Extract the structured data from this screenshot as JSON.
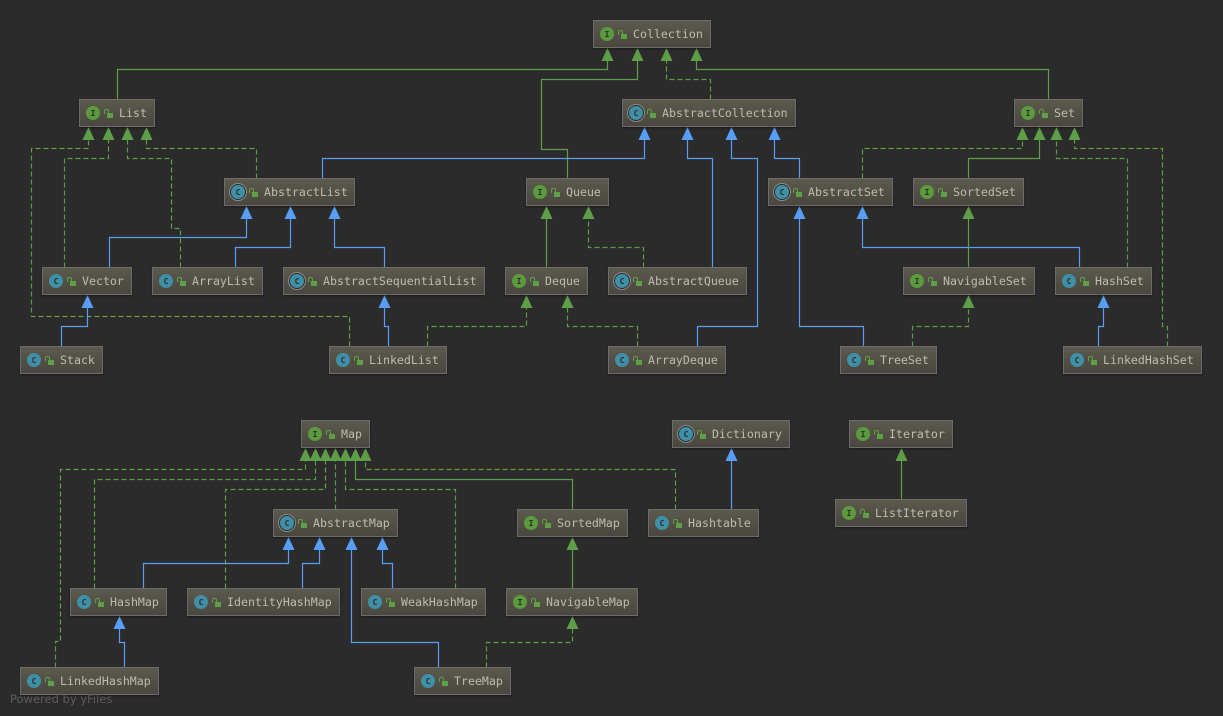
{
  "colors": {
    "background": "#2b2b2b",
    "interface_edge": "#5f9e48",
    "class_edge": "#589df6",
    "node_text": "#bcbcb4"
  },
  "nodes": [
    {
      "id": "Collection",
      "label": "Collection",
      "kind": "interface",
      "badge": "I"
    },
    {
      "id": "List",
      "label": "List",
      "kind": "interface",
      "badge": "I"
    },
    {
      "id": "AbstractCollection",
      "label": "AbstractCollection",
      "kind": "abstract",
      "badge": "C"
    },
    {
      "id": "Set",
      "label": "Set",
      "kind": "interface",
      "badge": "I"
    },
    {
      "id": "AbstractList",
      "label": "AbstractList",
      "kind": "abstract",
      "badge": "C"
    },
    {
      "id": "Queue",
      "label": "Queue",
      "kind": "interface",
      "badge": "I"
    },
    {
      "id": "AbstractSet",
      "label": "AbstractSet",
      "kind": "abstract",
      "badge": "C"
    },
    {
      "id": "SortedSet",
      "label": "SortedSet",
      "kind": "interface",
      "badge": "I"
    },
    {
      "id": "Vector",
      "label": "Vector",
      "kind": "class",
      "badge": "C"
    },
    {
      "id": "ArrayList",
      "label": "ArrayList",
      "kind": "class",
      "badge": "C"
    },
    {
      "id": "AbstractSequentialList",
      "label": "AbstractSequentialList",
      "kind": "abstract",
      "badge": "C"
    },
    {
      "id": "Deque",
      "label": "Deque",
      "kind": "interface",
      "badge": "I"
    },
    {
      "id": "AbstractQueue",
      "label": "AbstractQueue",
      "kind": "abstract",
      "badge": "C"
    },
    {
      "id": "NavigableSet",
      "label": "NavigableSet",
      "kind": "interface",
      "badge": "I"
    },
    {
      "id": "HashSet",
      "label": "HashSet",
      "kind": "class",
      "badge": "C"
    },
    {
      "id": "Stack",
      "label": "Stack",
      "kind": "class",
      "badge": "C"
    },
    {
      "id": "LinkedList",
      "label": "LinkedList",
      "kind": "class",
      "badge": "C"
    },
    {
      "id": "ArrayDeque",
      "label": "ArrayDeque",
      "kind": "class",
      "badge": "C"
    },
    {
      "id": "TreeSet",
      "label": "TreeSet",
      "kind": "class",
      "badge": "C"
    },
    {
      "id": "LinkedHashSet",
      "label": "LinkedHashSet",
      "kind": "class",
      "badge": "C"
    },
    {
      "id": "Map",
      "label": "Map",
      "kind": "interface",
      "badge": "I"
    },
    {
      "id": "Dictionary",
      "label": "Dictionary",
      "kind": "abstract",
      "badge": "C"
    },
    {
      "id": "Iterator",
      "label": "Iterator",
      "kind": "interface",
      "badge": "I"
    },
    {
      "id": "AbstractMap",
      "label": "AbstractMap",
      "kind": "abstract",
      "badge": "C"
    },
    {
      "id": "SortedMap",
      "label": "SortedMap",
      "kind": "interface",
      "badge": "I"
    },
    {
      "id": "Hashtable",
      "label": "Hashtable",
      "kind": "class",
      "badge": "C"
    },
    {
      "id": "ListIterator",
      "label": "ListIterator",
      "kind": "interface",
      "badge": "I"
    },
    {
      "id": "HashMap",
      "label": "HashMap",
      "kind": "class",
      "badge": "C"
    },
    {
      "id": "IdentityHashMap",
      "label": "IdentityHashMap",
      "kind": "class",
      "badge": "C"
    },
    {
      "id": "WeakHashMap",
      "label": "WeakHashMap",
      "kind": "class",
      "badge": "C"
    },
    {
      "id": "NavigableMap",
      "label": "NavigableMap",
      "kind": "interface",
      "badge": "I"
    },
    {
      "id": "LinkedHashMap",
      "label": "LinkedHashMap",
      "kind": "class",
      "badge": "C"
    },
    {
      "id": "TreeMap",
      "label": "TreeMap",
      "kind": "class",
      "badge": "C"
    }
  ],
  "edges": [
    {
      "from": "List",
      "to": "Collection",
      "type": "extends-interface"
    },
    {
      "from": "Queue",
      "to": "Collection",
      "type": "extends-interface"
    },
    {
      "from": "AbstractCollection",
      "to": "Collection",
      "type": "implements"
    },
    {
      "from": "Set",
      "to": "Collection",
      "type": "extends-interface"
    },
    {
      "from": "AbstractList",
      "to": "AbstractCollection",
      "type": "extends-class"
    },
    {
      "from": "AbstractQueue",
      "to": "AbstractCollection",
      "type": "extends-class"
    },
    {
      "from": "ArrayDeque",
      "to": "AbstractCollection",
      "type": "extends-class"
    },
    {
      "from": "AbstractSet",
      "to": "AbstractCollection",
      "type": "extends-class"
    },
    {
      "from": "LinkedList",
      "to": "List",
      "type": "implements"
    },
    {
      "from": "Vector",
      "to": "List",
      "type": "implements"
    },
    {
      "from": "ArrayList",
      "to": "List",
      "type": "implements"
    },
    {
      "from": "AbstractList",
      "to": "List",
      "type": "implements"
    },
    {
      "from": "Vector",
      "to": "AbstractList",
      "type": "extends-class"
    },
    {
      "from": "ArrayList",
      "to": "AbstractList",
      "type": "extends-class"
    },
    {
      "from": "AbstractSequentialList",
      "to": "AbstractList",
      "type": "extends-class"
    },
    {
      "from": "Stack",
      "to": "Vector",
      "type": "extends-class"
    },
    {
      "from": "LinkedList",
      "to": "AbstractSequentialList",
      "type": "extends-class"
    },
    {
      "from": "Deque",
      "to": "Queue",
      "type": "extends-interface"
    },
    {
      "from": "AbstractQueue",
      "to": "Queue",
      "type": "implements"
    },
    {
      "from": "LinkedList",
      "to": "Deque",
      "type": "implements"
    },
    {
      "from": "ArrayDeque",
      "to": "Deque",
      "type": "implements"
    },
    {
      "from": "AbstractSet",
      "to": "Set",
      "type": "implements"
    },
    {
      "from": "SortedSet",
      "to": "Set",
      "type": "extends-interface"
    },
    {
      "from": "HashSet",
      "to": "Set",
      "type": "implements"
    },
    {
      "from": "LinkedHashSet",
      "to": "Set",
      "type": "implements"
    },
    {
      "from": "TreeSet",
      "to": "AbstractSet",
      "type": "extends-class"
    },
    {
      "from": "HashSet",
      "to": "AbstractSet",
      "type": "extends-class"
    },
    {
      "from": "NavigableSet",
      "to": "SortedSet",
      "type": "extends-interface"
    },
    {
      "from": "TreeSet",
      "to": "NavigableSet",
      "type": "implements"
    },
    {
      "from": "LinkedHashSet",
      "to": "HashSet",
      "type": "extends-class"
    },
    {
      "from": "LinkedHashMap",
      "to": "Map",
      "type": "implements"
    },
    {
      "from": "HashMap",
      "to": "Map",
      "type": "implements"
    },
    {
      "from": "IdentityHashMap",
      "to": "Map",
      "type": "implements"
    },
    {
      "from": "AbstractMap",
      "to": "Map",
      "type": "implements"
    },
    {
      "from": "WeakHashMap",
      "to": "Map",
      "type": "implements"
    },
    {
      "from": "SortedMap",
      "to": "Map",
      "type": "extends-interface"
    },
    {
      "from": "Hashtable",
      "to": "Map",
      "type": "implements"
    },
    {
      "from": "Hashtable",
      "to": "Dictionary",
      "type": "extends-class"
    },
    {
      "from": "HashMap",
      "to": "AbstractMap",
      "type": "extends-class"
    },
    {
      "from": "IdentityHashMap",
      "to": "AbstractMap",
      "type": "extends-class"
    },
    {
      "from": "TreeMap",
      "to": "AbstractMap",
      "type": "extends-class"
    },
    {
      "from": "WeakHashMap",
      "to": "AbstractMap",
      "type": "extends-class"
    },
    {
      "from": "NavigableMap",
      "to": "SortedMap",
      "type": "extends-interface"
    },
    {
      "from": "TreeMap",
      "to": "NavigableMap",
      "type": "implements"
    },
    {
      "from": "LinkedHashMap",
      "to": "HashMap",
      "type": "extends-class"
    },
    {
      "from": "ListIterator",
      "to": "Iterator",
      "type": "extends-interface"
    }
  ],
  "footer": "Powered by yFiles"
}
